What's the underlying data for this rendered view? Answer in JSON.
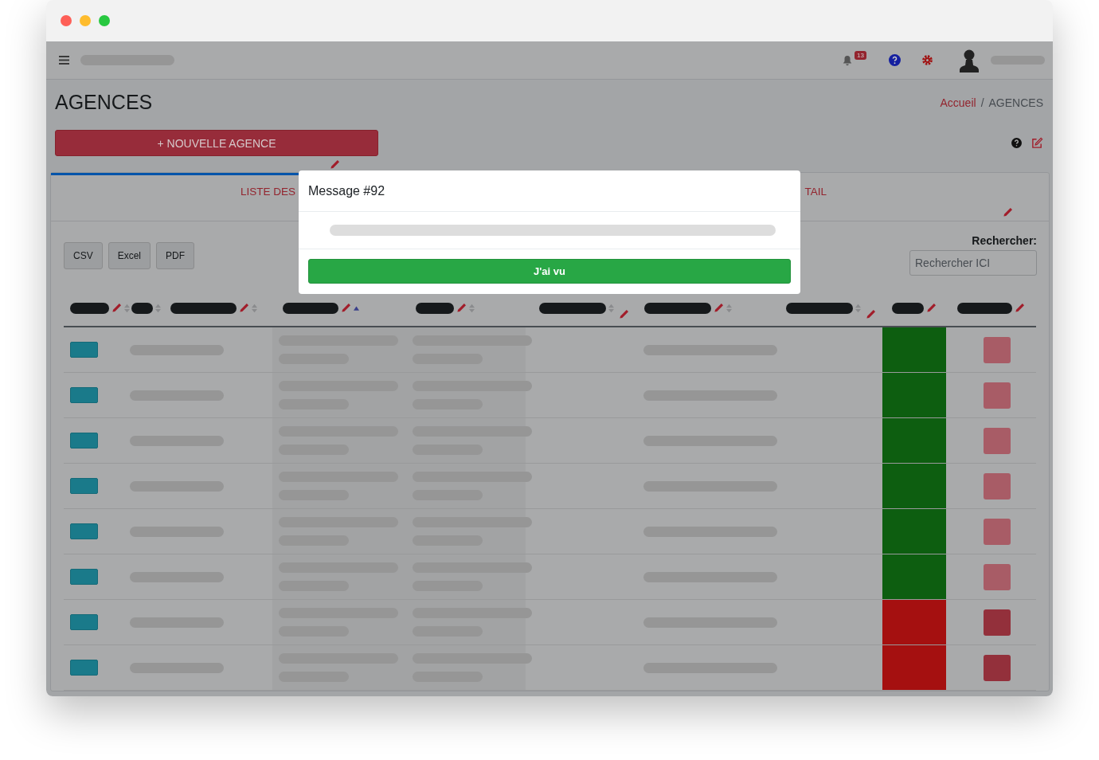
{
  "navbar": {
    "notifications": "13"
  },
  "page": {
    "title": "AGENCES",
    "breadcrumb": [
      {
        "label": "Accueil",
        "link": true
      },
      {
        "label": "AGENCES",
        "link": false
      }
    ],
    "separator": "/",
    "new_button": "+ NOUVELLE AGENCE"
  },
  "tabs": [
    {
      "label": "LISTE DES",
      "selected": true
    },
    {
      "label": "TAIL",
      "selected": false
    }
  ],
  "export_buttons": [
    "CSV",
    "Excel",
    "PDF"
  ],
  "search": {
    "label": "Rechercher:",
    "placeholder": "Rechercher ICI"
  },
  "table": {
    "columns": [
      {
        "kind": "sortable",
        "editable": true
      },
      {
        "kind": "sortable",
        "editable": false
      },
      {
        "kind": "sortable",
        "editable": true
      },
      {
        "kind": "sorted",
        "editable": true
      },
      {
        "kind": "sortable",
        "editable": true
      },
      {
        "kind": "sortable",
        "editable": true
      },
      {
        "kind": "sortable",
        "editable": true
      },
      {
        "kind": "sortable",
        "editable": true
      },
      {
        "kind": "plain",
        "editable": true
      },
      {
        "kind": "plain",
        "editable": true
      }
    ],
    "rows": [
      {
        "color": "#0d5e10",
        "flagged": false
      },
      {
        "color": "#0d5e10",
        "flagged": false
      },
      {
        "color": "#0d5e10",
        "flagged": false
      },
      {
        "color": "#0d5e10",
        "flagged": false
      },
      {
        "color": "#0d5e10",
        "flagged": false
      },
      {
        "color": "#0d5e10",
        "flagged": false
      },
      {
        "color": "#a51010",
        "flagged": true
      },
      {
        "color": "#a51010",
        "flagged": true
      }
    ]
  },
  "modal": {
    "title": "Message #92",
    "button": "J'ai vu"
  }
}
